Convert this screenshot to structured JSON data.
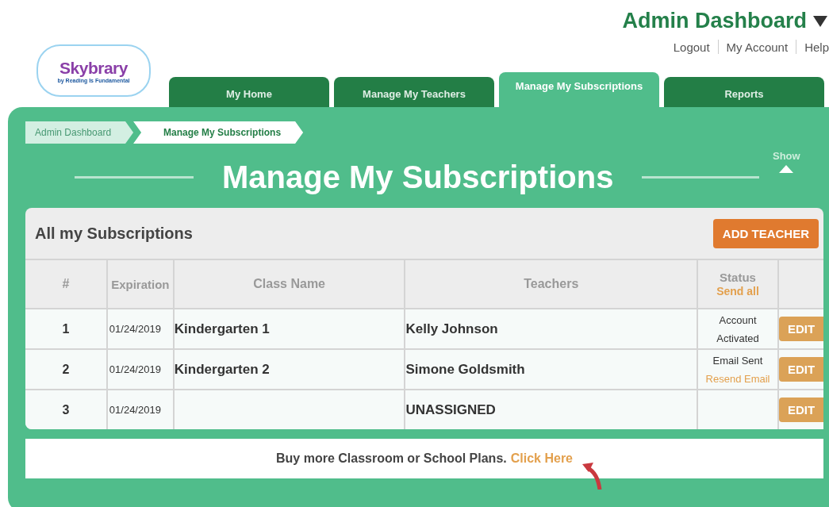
{
  "header": {
    "title": "Admin Dashboard",
    "links": [
      "Logout",
      "My Account",
      "Help"
    ]
  },
  "logo": {
    "name": "Skybrary",
    "tagline": "by Reading Is Fundamental"
  },
  "tabs": [
    {
      "label": "My Home",
      "selected": false
    },
    {
      "label": "Manage My Teachers",
      "selected": false
    },
    {
      "label": "Manage My Subscriptions",
      "selected": true
    },
    {
      "label": "Reports",
      "selected": false
    }
  ],
  "breadcrumb": [
    {
      "label": "Admin Dashboard",
      "selected": false
    },
    {
      "label": "Manage My Subscriptions",
      "selected": true
    }
  ],
  "page_title": "Manage My Subscriptions",
  "show_toggle": "Show",
  "card": {
    "title": "All my Subscriptions",
    "button": "ADD TEACHER",
    "columns": [
      "#",
      "Expiration",
      "Class Name",
      "Teachers",
      "Status"
    ],
    "send_all": "Send all",
    "rows": [
      {
        "number": "1",
        "expiration": "01/24/2019",
        "class_name": "Kindergarten 1",
        "teacher": "Kelly Johnson",
        "status": "Account Activated",
        "edit": "EDIT"
      },
      {
        "number": "2",
        "expiration": "01/24/2019",
        "class_name": "Kindergarten 2",
        "teacher": "Simone Goldsmith",
        "status": "Email Sent",
        "status_link": "Resend Email",
        "edit": "EDIT"
      },
      {
        "number": "3",
        "expiration": "01/24/2019",
        "teacher": "UNASSIGNED",
        "edit": "EDIT"
      }
    ]
  },
  "footer": {
    "text": "Buy more Classroom or School Plans.",
    "link": "Click Here"
  }
}
